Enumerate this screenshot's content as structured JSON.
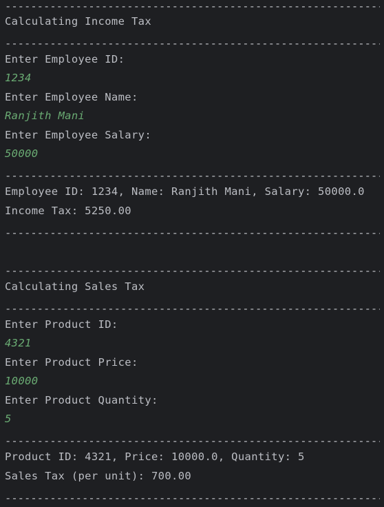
{
  "console": {
    "separator": "------------------------------------------------------------------------",
    "income": {
      "heading": "Calculating Income Tax",
      "prompt_id": "Enter Employee ID:",
      "input_id": "1234",
      "prompt_name": "Enter Employee Name:",
      "input_name": "Ranjith Mani",
      "prompt_salary": "Enter Employee Salary:",
      "input_salary": "50000",
      "summary": "Employee ID: 1234, Name: Ranjith Mani, Salary: 50000.0",
      "result": "Income Tax: 5250.00"
    },
    "sales": {
      "heading": "Calculating Sales Tax",
      "prompt_id": "Enter Product ID:",
      "input_id": "4321",
      "prompt_price": "Enter Product Price:",
      "input_price": "10000",
      "prompt_qty": "Enter Product Quantity:",
      "input_qty": "5",
      "summary": "Product ID: 4321, Price: 10000.0, Quantity: 5",
      "result": "Sales Tax (per unit): 700.00"
    },
    "colors": {
      "background": "#1e1f22",
      "text": "#bcbec4",
      "user_input": "#6aab73"
    }
  }
}
